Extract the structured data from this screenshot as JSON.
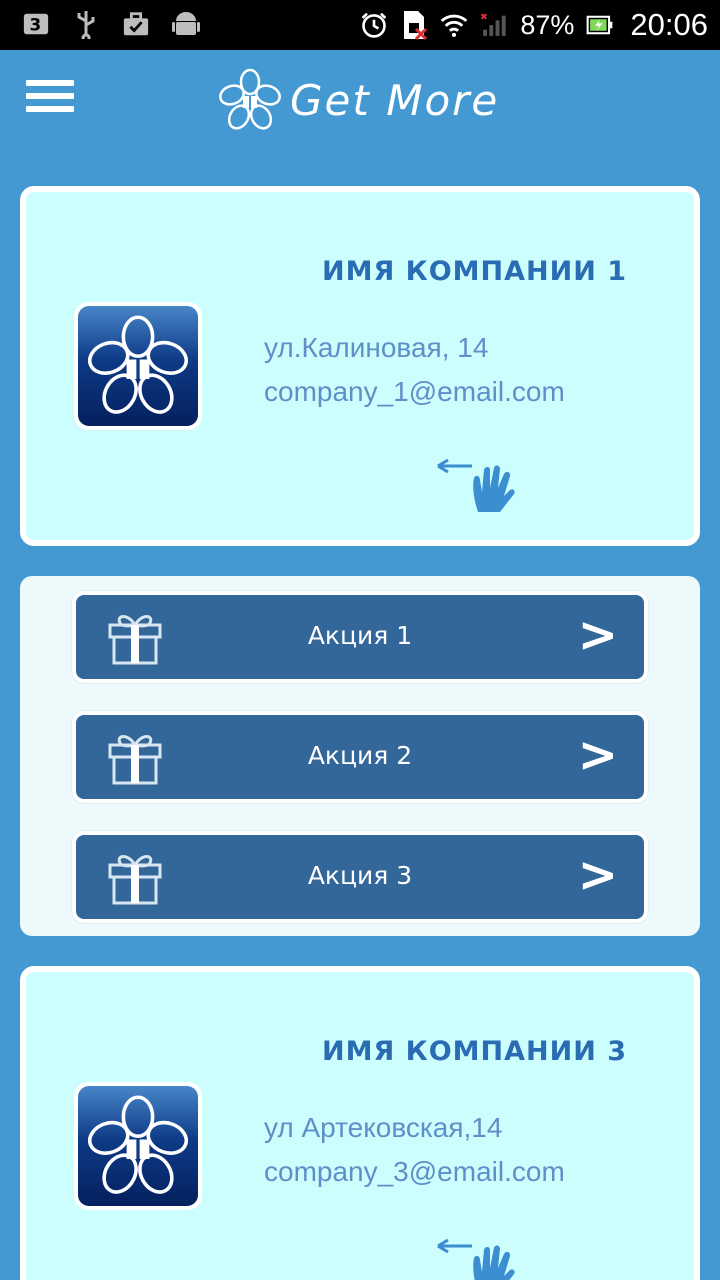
{
  "statusbar": {
    "battery": "87%",
    "time": "20:06"
  },
  "app": {
    "title": "Get More"
  },
  "companies": [
    {
      "name": "ИМЯ КОМПАНИИ 1",
      "address": "ул.Калиновая, 14",
      "email": "company_1@email.com"
    },
    {
      "name": "ИМЯ КОМПАНИИ 3",
      "address": "ул Артековская,14",
      "email": "company_3@email.com"
    }
  ],
  "promotions": [
    {
      "label": "Акция 1",
      "arrow": ">"
    },
    {
      "label": "Акция 2",
      "arrow": ">"
    },
    {
      "label": "Акция 3",
      "arrow": ">"
    }
  ],
  "colors": {
    "background": "#4499d2",
    "card": "#ccfefe",
    "promo_button": "#336699",
    "title_text": "#2a6cb3",
    "info_text": "#5f8fc8"
  },
  "icons": [
    "menu-icon",
    "flower-logo-icon",
    "gift-icon",
    "swipe-hand-icon",
    "chevron-right-icon"
  ]
}
